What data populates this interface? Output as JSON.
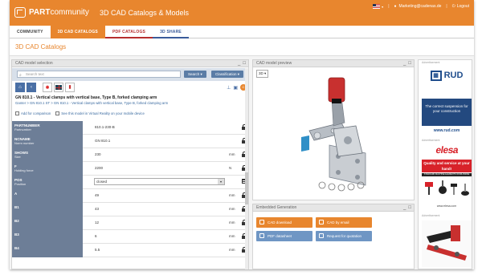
{
  "header": {
    "logo_part": "PART",
    "logo_rest": "community",
    "title": "3D CAD Catalogs & Models",
    "email": "Marketing@cadenas.de",
    "logout": "Logout",
    "accent": "#e8862e"
  },
  "tabs": [
    {
      "label": "COMMUNITY"
    },
    {
      "label": "3D CAD CATALOGS"
    },
    {
      "label": "PDF CATALOGS"
    },
    {
      "label": "3D SHARE"
    }
  ],
  "page_title": "3D CAD Catalogs",
  "left_panel": {
    "title": "CAD model selection",
    "search_placeholder": "Search text",
    "search_button": "Search",
    "classification_button": "Classification",
    "part_title": "GN 810.1 - Vertical clamps with vertical base, Type B, forked clamping arm",
    "breadcrumb": "Ganter  >  GN 810.1 ST  >  GN 810.1 - Vertical clamps with vertical base, Type B, forked clamping arm",
    "add_comparison": "Add for comparison",
    "view_vr": "See this model in Virtual Reality on your mobile device",
    "params": [
      {
        "key": "PARTNUMBER",
        "desc": "Partnumber",
        "value": "810.1-230-B",
        "unit": ""
      },
      {
        "key": "NCNAME",
        "desc": "Norm number",
        "value": "GN 810.1",
        "unit": ""
      },
      {
        "key": "SHOWS",
        "desc": "Size",
        "value": "230",
        "unit": "mm"
      },
      {
        "key": "F",
        "desc": "Holding force",
        "value": "2200",
        "unit": "N"
      },
      {
        "key": "POS",
        "desc": "Position",
        "value": "closed",
        "unit": ""
      },
      {
        "key": "A",
        "desc": "",
        "value": "49",
        "unit": "mm"
      },
      {
        "key": "B1",
        "desc": "",
        "value": "43",
        "unit": "mm"
      },
      {
        "key": "B2",
        "desc": "",
        "value": "12",
        "unit": "mm"
      },
      {
        "key": "B3",
        "desc": "",
        "value": "6",
        "unit": "mm"
      },
      {
        "key": "B4",
        "desc": "",
        "value": "5.5",
        "unit": "mm"
      }
    ]
  },
  "preview_panel": {
    "title": "CAD model preview",
    "mode": "3D"
  },
  "embedded_panel": {
    "title": "Embedded Generation",
    "buttons": [
      {
        "label": "CAD download"
      },
      {
        "label": "CAD by email"
      },
      {
        "label": "PDF datasheet"
      },
      {
        "label": "Request for quotation"
      }
    ]
  },
  "ads": {
    "label": "Advertisement",
    "rud_logo": "RUD",
    "rud_banner": "The correct suspension for your construction",
    "rud_url": "www.rud.com",
    "elesa_logo": "elesa",
    "elesa_slogan": "Quality and service at your hand!",
    "elesa_band": "STANDARD MACHINE ELEMENTS WORLDWIDE",
    "elesa_url": "www.elesa.com"
  }
}
